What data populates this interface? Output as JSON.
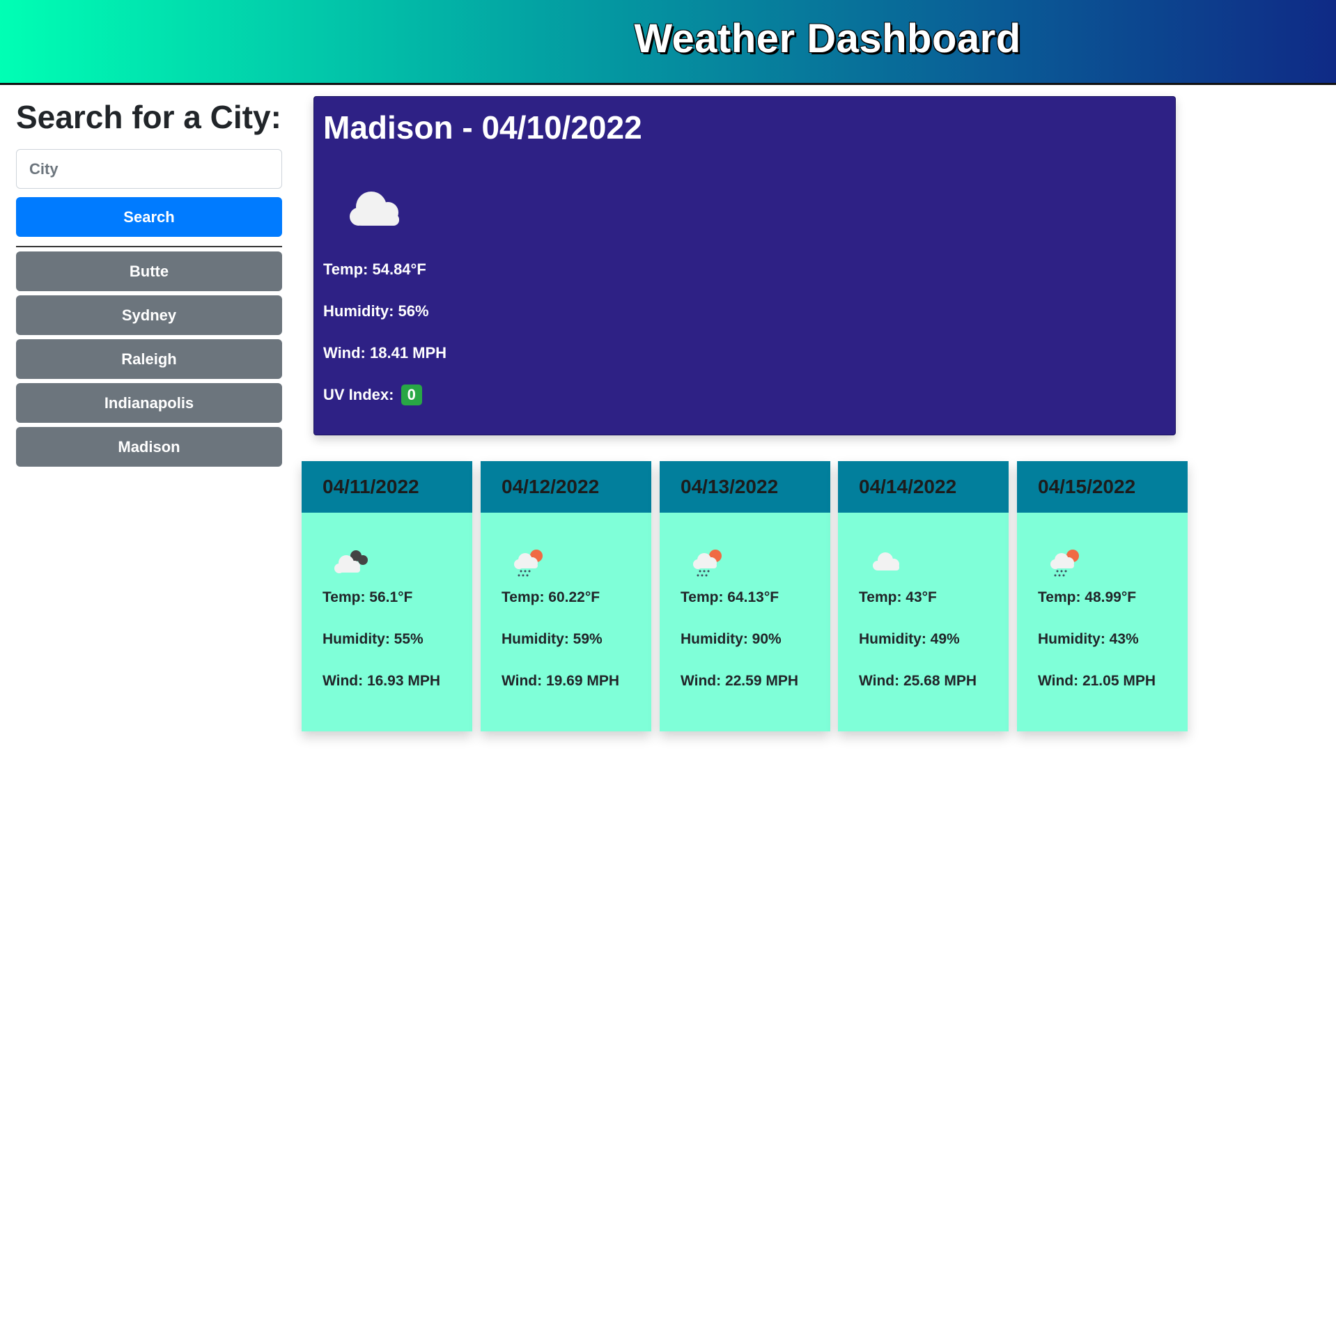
{
  "header": {
    "title": "Weather Dashboard"
  },
  "sidebar": {
    "title": "Search for a City:",
    "input_placeholder": "City",
    "input_value": "",
    "search_label": "Search",
    "history": [
      "Butte",
      "Sydney",
      "Raleigh",
      "Indianapolis",
      "Madison"
    ]
  },
  "current": {
    "title": "Madison - 04/10/2022",
    "icon": "cloud-icon",
    "temp": "Temp: 54.84°F",
    "humidity": "Humidity: 56%",
    "wind": "Wind: 18.41 MPH",
    "uv_label": "UV Index:",
    "uv_value": "0",
    "uv_color": "#28a745"
  },
  "forecast": [
    {
      "date": "04/11/2022",
      "icon": "broken-clouds-icon",
      "temp": "Temp: 56.1°F",
      "humidity": "Humidity: 55%",
      "wind": "Wind: 16.93 MPH"
    },
    {
      "date": "04/12/2022",
      "icon": "sun-rain-icon",
      "temp": "Temp: 60.22°F",
      "humidity": "Humidity: 59%",
      "wind": "Wind: 19.69 MPH"
    },
    {
      "date": "04/13/2022",
      "icon": "sun-rain-icon",
      "temp": "Temp: 64.13°F",
      "humidity": "Humidity: 90%",
      "wind": "Wind: 22.59 MPH"
    },
    {
      "date": "04/14/2022",
      "icon": "cloud-icon",
      "temp": "Temp: 43°F",
      "humidity": "Humidity: 49%",
      "wind": "Wind: 25.68 MPH"
    },
    {
      "date": "04/15/2022",
      "icon": "sun-rain-icon",
      "temp": "Temp: 48.99°F",
      "humidity": "Humidity: 43%",
      "wind": "Wind: 21.05 MPH"
    }
  ],
  "colors": {
    "header_gradient_start": "#00ffb4",
    "header_gradient_end": "#0f2a86",
    "current_card_bg": "#2e2185",
    "forecast_card_bg": "#7fffd8",
    "forecast_head_bg": "#027f9c",
    "search_button": "#007bff",
    "history_button": "#6c757d"
  }
}
